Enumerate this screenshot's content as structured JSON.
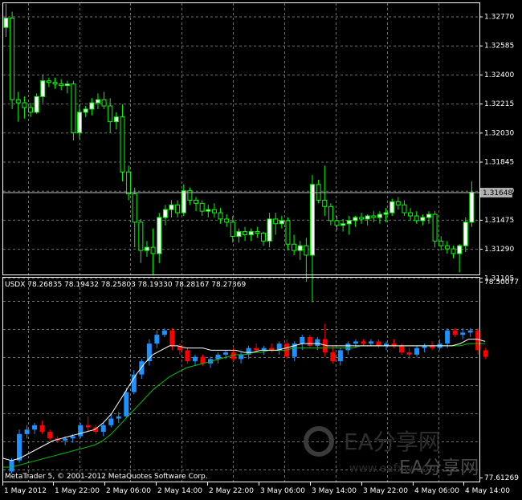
{
  "colors": {
    "background": "#000000",
    "grid": "#6f6f6f",
    "axis_text": "#ffffff",
    "bull_candle": "#ffffff",
    "bear_candle": "#000000",
    "candle_outline": "#00ff00",
    "index_up": "#1e90ff",
    "index_down": "#ff0000",
    "ma_fast": "#ffffff",
    "ma_slow": "#00c000",
    "price_label_bg": "#b0b0b0",
    "watermark": "#3a3a3a"
  },
  "chart_data": [
    {
      "type": "candlestick",
      "y_ticks": [
        "1.32770",
        "1.32585",
        "1.32400",
        "1.32215",
        "1.32030",
        "1.31845",
        "1.31660",
        "1.31475",
        "1.31290",
        "1.31105"
      ],
      "ylim": [
        1.3102,
        1.3288
      ],
      "current_price": "1.31648",
      "candles": [
        [
          1.327,
          1.3285,
          1.3264,
          1.3276
        ],
        [
          1.3276,
          1.328,
          1.3218,
          1.3224
        ],
        [
          1.3224,
          1.3229,
          1.321,
          1.3222
        ],
        [
          1.3222,
          1.3226,
          1.3212,
          1.3219
        ],
        [
          1.3219,
          1.3222,
          1.3213,
          1.3216
        ],
        [
          1.3216,
          1.3228,
          1.3215,
          1.3226
        ],
        [
          1.3226,
          1.324,
          1.3222,
          1.3236
        ],
        [
          1.3236,
          1.3238,
          1.3232,
          1.3235
        ],
        [
          1.3235,
          1.3238,
          1.3231,
          1.3234
        ],
        [
          1.3234,
          1.3237,
          1.323,
          1.3233
        ],
        [
          1.3233,
          1.3236,
          1.3228,
          1.3234
        ],
        [
          1.3234,
          1.3236,
          1.3198,
          1.3203
        ],
        [
          1.3203,
          1.3221,
          1.3199,
          1.3216
        ],
        [
          1.3216,
          1.322,
          1.3213,
          1.3218
        ],
        [
          1.3218,
          1.3225,
          1.3214,
          1.3222
        ],
        [
          1.3222,
          1.3228,
          1.3218,
          1.3224
        ],
        [
          1.3224,
          1.3229,
          1.3218,
          1.322
        ],
        [
          1.322,
          1.3225,
          1.3203,
          1.321
        ],
        [
          1.321,
          1.3216,
          1.3205,
          1.3213
        ],
        [
          1.3213,
          1.3221,
          1.3172,
          1.3178
        ],
        [
          1.3178,
          1.3182,
          1.316,
          1.3164
        ],
        [
          1.3164,
          1.3168,
          1.313,
          1.3146
        ],
        [
          1.3146,
          1.3148,
          1.312,
          1.3128
        ],
        [
          1.3128,
          1.3134,
          1.3124,
          1.313
        ],
        [
          1.313,
          1.3142,
          1.3112,
          1.3126
        ],
        [
          1.3126,
          1.3152,
          1.312,
          1.3149
        ],
        [
          1.3149,
          1.3157,
          1.3144,
          1.3154
        ],
        [
          1.3154,
          1.316,
          1.3149,
          1.3157
        ],
        [
          1.3157,
          1.316,
          1.3149,
          1.3152
        ],
        [
          1.3152,
          1.317,
          1.315,
          1.3166
        ],
        [
          1.3166,
          1.3168,
          1.3157,
          1.316
        ],
        [
          1.316,
          1.3162,
          1.3153,
          1.3158
        ],
        [
          1.3158,
          1.316,
          1.315,
          1.3153
        ],
        [
          1.3153,
          1.3157,
          1.3149,
          1.3154
        ],
        [
          1.3154,
          1.3158,
          1.3149,
          1.3152
        ],
        [
          1.3152,
          1.3155,
          1.3145,
          1.3148
        ],
        [
          1.3148,
          1.3151,
          1.3143,
          1.3146
        ],
        [
          1.3146,
          1.315,
          1.3133,
          1.3137
        ],
        [
          1.3137,
          1.3142,
          1.3133,
          1.314
        ],
        [
          1.314,
          1.3143,
          1.3134,
          1.3138
        ],
        [
          1.3138,
          1.3142,
          1.3134,
          1.314
        ],
        [
          1.314,
          1.3143,
          1.3136,
          1.3139
        ],
        [
          1.3139,
          1.314,
          1.3131,
          1.3134
        ],
        [
          1.3134,
          1.3152,
          1.313,
          1.3148
        ],
        [
          1.3148,
          1.3152,
          1.3138,
          1.3145
        ],
        [
          1.3145,
          1.315,
          1.3142,
          1.3147
        ],
        [
          1.3147,
          1.3149,
          1.3128,
          1.3132
        ],
        [
          1.3132,
          1.3138,
          1.3125,
          1.3128
        ],
        [
          1.3128,
          1.3134,
          1.3122,
          1.3131
        ],
        [
          1.3131,
          1.3136,
          1.3108,
          1.3125
        ],
        [
          1.3125,
          1.3176,
          1.3095,
          1.317
        ],
        [
          1.317,
          1.3173,
          1.3158,
          1.316
        ],
        [
          1.316,
          1.3182,
          1.315,
          1.3156
        ],
        [
          1.3156,
          1.3158,
          1.3144,
          1.3147
        ],
        [
          1.3147,
          1.315,
          1.3141,
          1.3144
        ],
        [
          1.3144,
          1.3148,
          1.314,
          1.3145
        ],
        [
          1.3145,
          1.315,
          1.3138,
          1.3147
        ],
        [
          1.3147,
          1.315,
          1.3143,
          1.3149
        ],
        [
          1.3149,
          1.3152,
          1.3145,
          1.3148
        ],
        [
          1.3148,
          1.3151,
          1.3144,
          1.315
        ],
        [
          1.315,
          1.3153,
          1.3146,
          1.3149
        ],
        [
          1.3149,
          1.3153,
          1.3145,
          1.3151
        ],
        [
          1.3151,
          1.3155,
          1.3146,
          1.3152
        ],
        [
          1.3152,
          1.3161,
          1.315,
          1.3159
        ],
        [
          1.3159,
          1.3162,
          1.3154,
          1.3157
        ],
        [
          1.3157,
          1.316,
          1.315,
          1.3152
        ],
        [
          1.3152,
          1.3155,
          1.3147,
          1.315
        ],
        [
          1.315,
          1.3153,
          1.3145,
          1.3147
        ],
        [
          1.3147,
          1.3151,
          1.3144,
          1.3149
        ],
        [
          1.3149,
          1.3153,
          1.3145,
          1.3151
        ],
        [
          1.3151,
          1.3153,
          1.313,
          1.3134
        ],
        [
          1.3134,
          1.3137,
          1.3128,
          1.3131
        ],
        [
          1.3131,
          1.3134,
          1.3126,
          1.3129
        ],
        [
          1.3129,
          1.3131,
          1.3123,
          1.3126
        ],
        [
          1.3126,
          1.3132,
          1.3114,
          1.3131
        ],
        [
          1.3131,
          1.3149,
          1.3127,
          1.3146
        ],
        [
          1.3146,
          1.3172,
          1.3143,
          1.3165
        ]
      ]
    },
    {
      "type": "candlestick",
      "indicator": "USDX",
      "header": "USDX 78.26835 78.19432 78.25803 78.19330 78.28167 78.27369",
      "y_ticks": [
        "78.50077",
        "77.61269"
      ],
      "ylim": [
        77.61269,
        78.50077
      ],
      "candles": [
        [
          77.64,
          77.7,
          77.63,
          77.69
        ],
        [
          77.69,
          77.83,
          77.68,
          77.81
        ],
        [
          77.81,
          77.85,
          77.79,
          77.83
        ],
        [
          77.83,
          77.86,
          77.81,
          77.85
        ],
        [
          77.85,
          77.87,
          77.81,
          77.82
        ],
        [
          77.82,
          77.83,
          77.78,
          77.79
        ],
        [
          77.79,
          77.8,
          77.77,
          77.78
        ],
        [
          77.78,
          77.8,
          77.76,
          77.79
        ],
        [
          77.79,
          77.81,
          77.77,
          77.8
        ],
        [
          77.8,
          77.86,
          77.79,
          77.85
        ],
        [
          77.85,
          77.89,
          77.82,
          77.84
        ],
        [
          77.84,
          77.85,
          77.81,
          77.82
        ],
        [
          77.82,
          77.86,
          77.8,
          77.85
        ],
        [
          77.85,
          77.9,
          77.84,
          77.88
        ],
        [
          77.88,
          77.91,
          77.86,
          77.89
        ],
        [
          77.89,
          78.02,
          77.88,
          78.0
        ],
        [
          78.0,
          78.1,
          77.99,
          78.08
        ],
        [
          78.08,
          78.15,
          78.06,
          78.14
        ],
        [
          78.14,
          78.24,
          78.12,
          78.22
        ],
        [
          78.22,
          78.28,
          78.2,
          78.26
        ],
        [
          78.26,
          78.29,
          78.25,
          78.28
        ],
        [
          78.28,
          78.29,
          78.19,
          78.21
        ],
        [
          78.21,
          78.22,
          78.17,
          78.19
        ],
        [
          78.19,
          78.2,
          78.13,
          78.14
        ],
        [
          78.14,
          78.17,
          78.12,
          78.16
        ],
        [
          78.16,
          78.17,
          78.12,
          78.13
        ],
        [
          78.13,
          78.16,
          78.11,
          78.15
        ],
        [
          78.15,
          78.18,
          78.13,
          78.17
        ],
        [
          78.17,
          78.19,
          78.15,
          78.18
        ],
        [
          78.18,
          78.2,
          78.14,
          78.15
        ],
        [
          78.15,
          78.18,
          78.13,
          78.17
        ],
        [
          78.17,
          78.21,
          78.15,
          78.2
        ],
        [
          78.2,
          78.22,
          78.18,
          78.19
        ],
        [
          78.19,
          78.21,
          78.17,
          78.2
        ],
        [
          78.2,
          78.22,
          78.18,
          78.19
        ],
        [
          78.19,
          78.23,
          78.17,
          78.22
        ],
        [
          78.22,
          78.24,
          78.15,
          78.16
        ],
        [
          78.16,
          78.23,
          78.14,
          78.22
        ],
        [
          78.22,
          78.26,
          78.19,
          78.25
        ],
        [
          78.25,
          78.26,
          78.2,
          78.21
        ],
        [
          78.21,
          78.25,
          78.19,
          78.24
        ],
        [
          78.24,
          78.31,
          78.16,
          78.18
        ],
        [
          78.18,
          78.21,
          78.13,
          78.14
        ],
        [
          78.14,
          78.2,
          78.12,
          78.19
        ],
        [
          78.19,
          78.23,
          78.17,
          78.22
        ],
        [
          78.22,
          78.24,
          78.2,
          78.23
        ],
        [
          78.23,
          78.24,
          78.21,
          78.22
        ],
        [
          78.22,
          78.24,
          78.21,
          78.23
        ],
        [
          78.23,
          78.24,
          78.2,
          78.21
        ],
        [
          78.21,
          78.23,
          78.19,
          78.22
        ],
        [
          78.22,
          78.24,
          78.2,
          78.21
        ],
        [
          78.21,
          78.22,
          78.17,
          78.18
        ],
        [
          78.18,
          78.2,
          78.15,
          78.17
        ],
        [
          78.17,
          78.21,
          78.16,
          78.2
        ],
        [
          78.2,
          78.22,
          78.18,
          78.21
        ],
        [
          78.21,
          78.23,
          78.19,
          78.2
        ],
        [
          78.2,
          78.24,
          78.19,
          78.22
        ],
        [
          78.22,
          78.29,
          78.2,
          78.28
        ],
        [
          78.28,
          78.29,
          78.25,
          78.26
        ],
        [
          78.26,
          78.29,
          78.24,
          78.27
        ],
        [
          78.27,
          78.29,
          78.25,
          78.28
        ],
        [
          78.28,
          78.29,
          78.17,
          78.19
        ],
        [
          78.19,
          78.2,
          78.15,
          78.16
        ]
      ],
      "ma_fast": [
        77.7,
        77.69,
        77.7,
        77.72,
        77.74,
        77.76,
        77.78,
        77.79,
        77.8,
        77.81,
        77.82,
        77.83,
        77.86,
        77.9,
        77.96,
        78.02,
        78.08,
        78.13,
        78.17,
        78.19,
        78.21,
        78.21,
        78.2,
        78.2,
        78.2,
        78.19,
        78.19,
        78.19,
        78.19,
        78.18,
        78.18,
        78.19,
        78.19,
        78.19,
        78.2,
        78.21,
        78.22,
        78.22,
        78.22,
        78.21,
        78.21,
        78.21,
        78.21,
        78.21,
        78.21,
        78.21,
        78.21,
        78.21,
        78.21,
        78.21,
        78.21,
        78.21,
        78.21,
        78.21,
        78.21,
        78.22,
        78.24,
        78.24,
        78.23
      ],
      "ma_slow": [
        77.66,
        77.66,
        77.67,
        77.68,
        77.69,
        77.7,
        77.71,
        77.72,
        77.73,
        77.74,
        77.75,
        77.76,
        77.78,
        77.81,
        77.85,
        77.89,
        77.93,
        77.97,
        78.01,
        78.04,
        78.07,
        78.09,
        78.11,
        78.12,
        78.13,
        78.14,
        78.15,
        78.16,
        78.17,
        78.17,
        78.18,
        78.18,
        78.19,
        78.19,
        78.19,
        78.2,
        78.2,
        78.2,
        78.2,
        78.2,
        78.2,
        78.2,
        78.2,
        78.21,
        78.21,
        78.21,
        78.21,
        78.21,
        78.21,
        78.21,
        78.21,
        78.21,
        78.21,
        78.21,
        78.21,
        78.21,
        78.22,
        78.22,
        78.22
      ]
    }
  ],
  "time_labels": [
    "1 May 2012",
    "1 May 22:00",
    "2 May 06:00",
    "2 May 14:00",
    "2 May 22:00",
    "3 May 06:00",
    "3 May 14:00",
    "3 May 22:00",
    "4 May 06:00",
    "4 May 14:00"
  ],
  "copyright": "MetaTrader 5, © 2001-2012 MetaQuotes Software Corp.",
  "watermark": {
    "text1": "EA分享网",
    "text2": "EA分享网",
    "url": "www.eafxw.com"
  }
}
